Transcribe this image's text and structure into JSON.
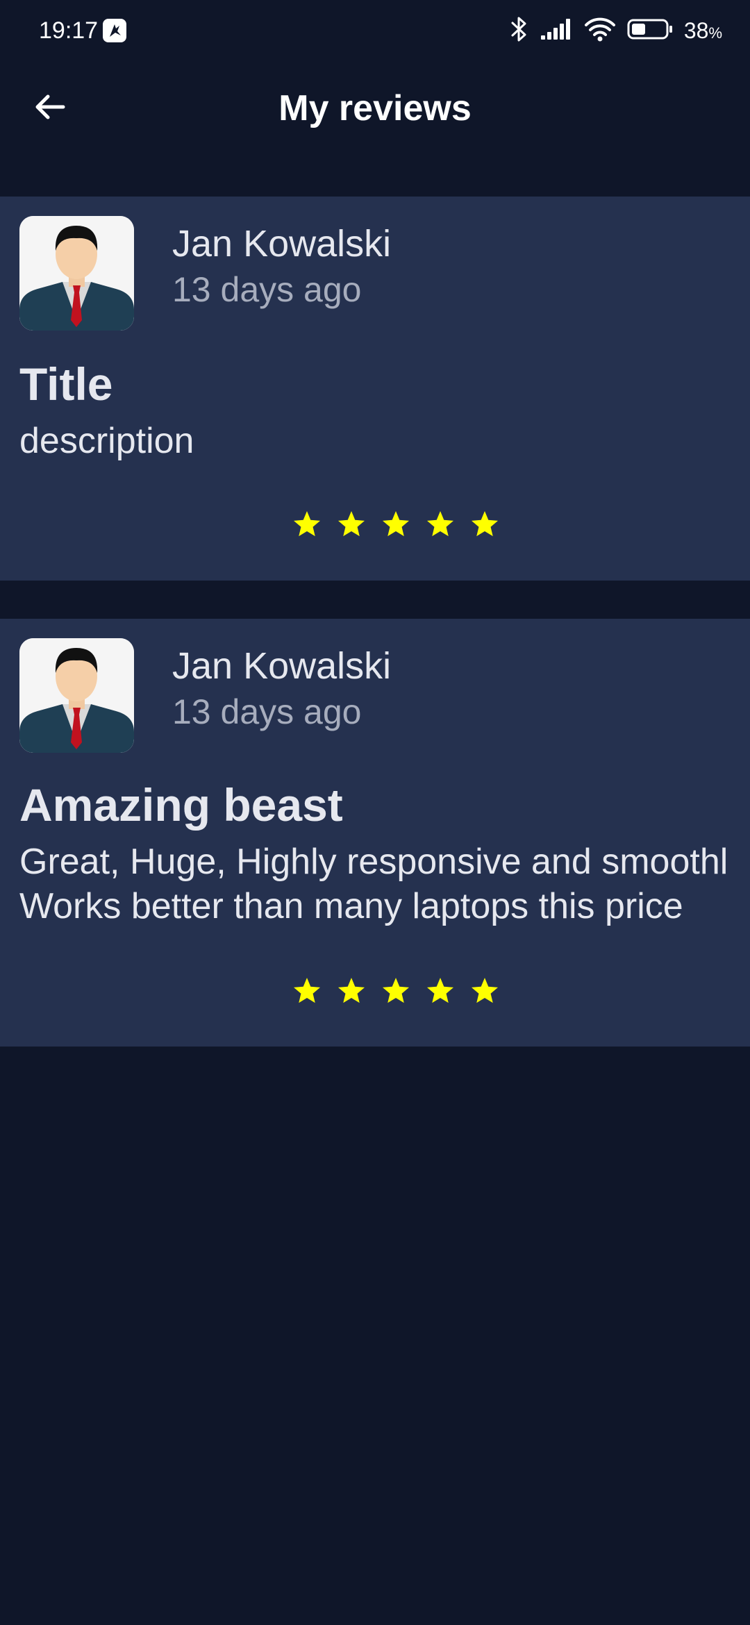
{
  "status_bar": {
    "time": "19:17",
    "battery_percent": "38",
    "battery_unit": "%",
    "battery_level": 0.38
  },
  "app_bar": {
    "title": "My reviews",
    "back_icon": "arrow-left-icon"
  },
  "reviews": [
    {
      "author": "Jan Kowalski",
      "date": "13 days ago",
      "title": "Title",
      "description": [
        "description"
      ],
      "rating": 5,
      "rating_max": 5
    },
    {
      "author": "Jan Kowalski",
      "date": "13 days ago",
      "title": "Amazing beast",
      "description": [
        "Great, Huge, Highly responsive and smoothl",
        "Works better than many laptops this price"
      ],
      "rating": 5,
      "rating_max": 5
    }
  ],
  "colors": {
    "background": "#0f1629",
    "card": "#25314f",
    "star": "#ffff00",
    "text_primary": "#e6e8ef",
    "text_secondary": "#a7adbd"
  }
}
